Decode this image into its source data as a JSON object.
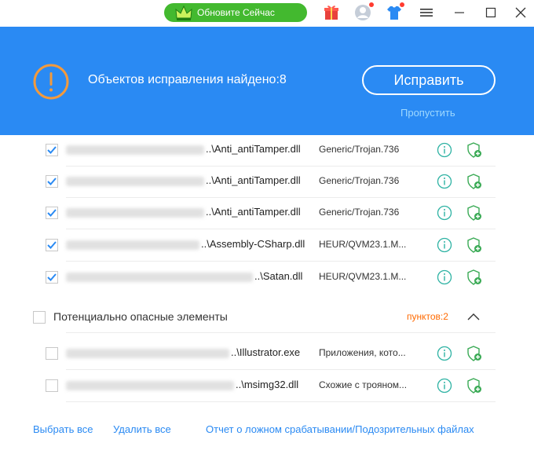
{
  "titlebar": {
    "update_label": "Обновите Сейчас",
    "icons": [
      "crown-icon",
      "gift-icon",
      "avatar-icon",
      "shirt-icon",
      "menu-icon",
      "minimize-icon",
      "maximize-icon",
      "close-icon"
    ]
  },
  "banner": {
    "message": "Объектов исправления найдено:8",
    "fix_label": "Исправить",
    "skip_label": "Пропустить",
    "color": "#2a8af3"
  },
  "items": [
    {
      "file": "..\\Anti_antiTamper.dll",
      "threat": "Generic/Trojan.736",
      "checked": true
    },
    {
      "file": "..\\Anti_antiTamper.dll",
      "threat": "Generic/Trojan.736",
      "checked": true
    },
    {
      "file": "..\\Anti_antiTamper.dll",
      "threat": "Generic/Trojan.736",
      "checked": true
    },
    {
      "file": "..\\Assembly-CSharp.dll",
      "threat": "HEUR/QVM23.1.M...",
      "checked": true
    },
    {
      "file": "..\\Satan.dll",
      "threat": "HEUR/QVM23.1.M...",
      "checked": true
    }
  ],
  "group": {
    "label": "Потенциально опасные элементы",
    "count": "пунктов:2"
  },
  "group_items": [
    {
      "file": "..\\Illustrator.exe",
      "threat": "Приложения, кото...",
      "checked": false
    },
    {
      "file": "..\\msimg32.dll",
      "threat": "Схожие с трояном...",
      "checked": false
    }
  ],
  "footer": {
    "select_all": "Выбрать все",
    "delete_all": "Удалить все",
    "report": "Отчет о ложном срабатывании/Подозрительных файлах"
  }
}
